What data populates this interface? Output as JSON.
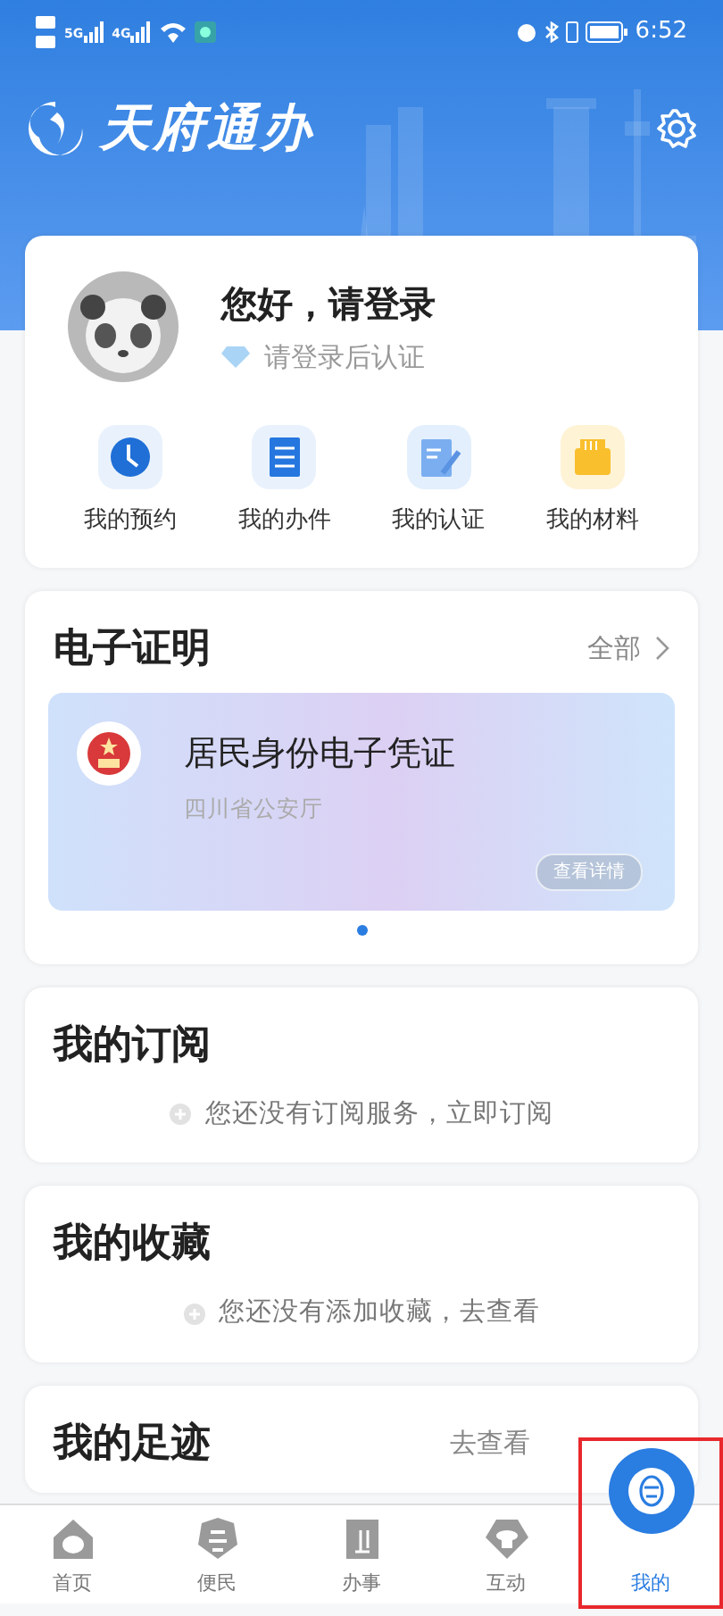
{
  "status_bar": {
    "networks": [
      "5G",
      "4G"
    ],
    "time": "6:52"
  },
  "header": {
    "app_name": "天府通办"
  },
  "profile": {
    "greeting": "您好，请登录",
    "hint": "请登录后认证"
  },
  "shortcuts": [
    {
      "label": "我的预约",
      "kind": "clock"
    },
    {
      "label": "我的办件",
      "kind": "document"
    },
    {
      "label": "我的认证",
      "kind": "edit"
    },
    {
      "label": "我的材料",
      "kind": "folder"
    }
  ],
  "certificates": {
    "title": "电子证明",
    "link": "全部",
    "card": {
      "name": "居民身份电子凭证",
      "issuer": "四川省公安厅",
      "button": "查看详情"
    },
    "pages": [
      {
        "selected": true
      }
    ]
  },
  "sections": [
    {
      "title": "我的订阅",
      "empty_text": "您还没有订阅服务，立即订阅"
    },
    {
      "title": "我的收藏",
      "empty_text": "您还没有添加收藏，去查看"
    },
    {
      "title": "我的足迹",
      "link": "去查看"
    }
  ],
  "tab_bar": [
    {
      "label": "首页",
      "kind": "home",
      "selected": false,
      "highlighted": false
    },
    {
      "label": "便民",
      "kind": "pagoda",
      "selected": false,
      "highlighted": false
    },
    {
      "label": "办事",
      "kind": "clipboard",
      "selected": false,
      "highlighted": false
    },
    {
      "label": "互动",
      "kind": "diamond",
      "selected": false,
      "highlighted": false
    },
    {
      "label": "我的",
      "kind": "mask",
      "selected": true,
      "highlighted": true
    }
  ]
}
